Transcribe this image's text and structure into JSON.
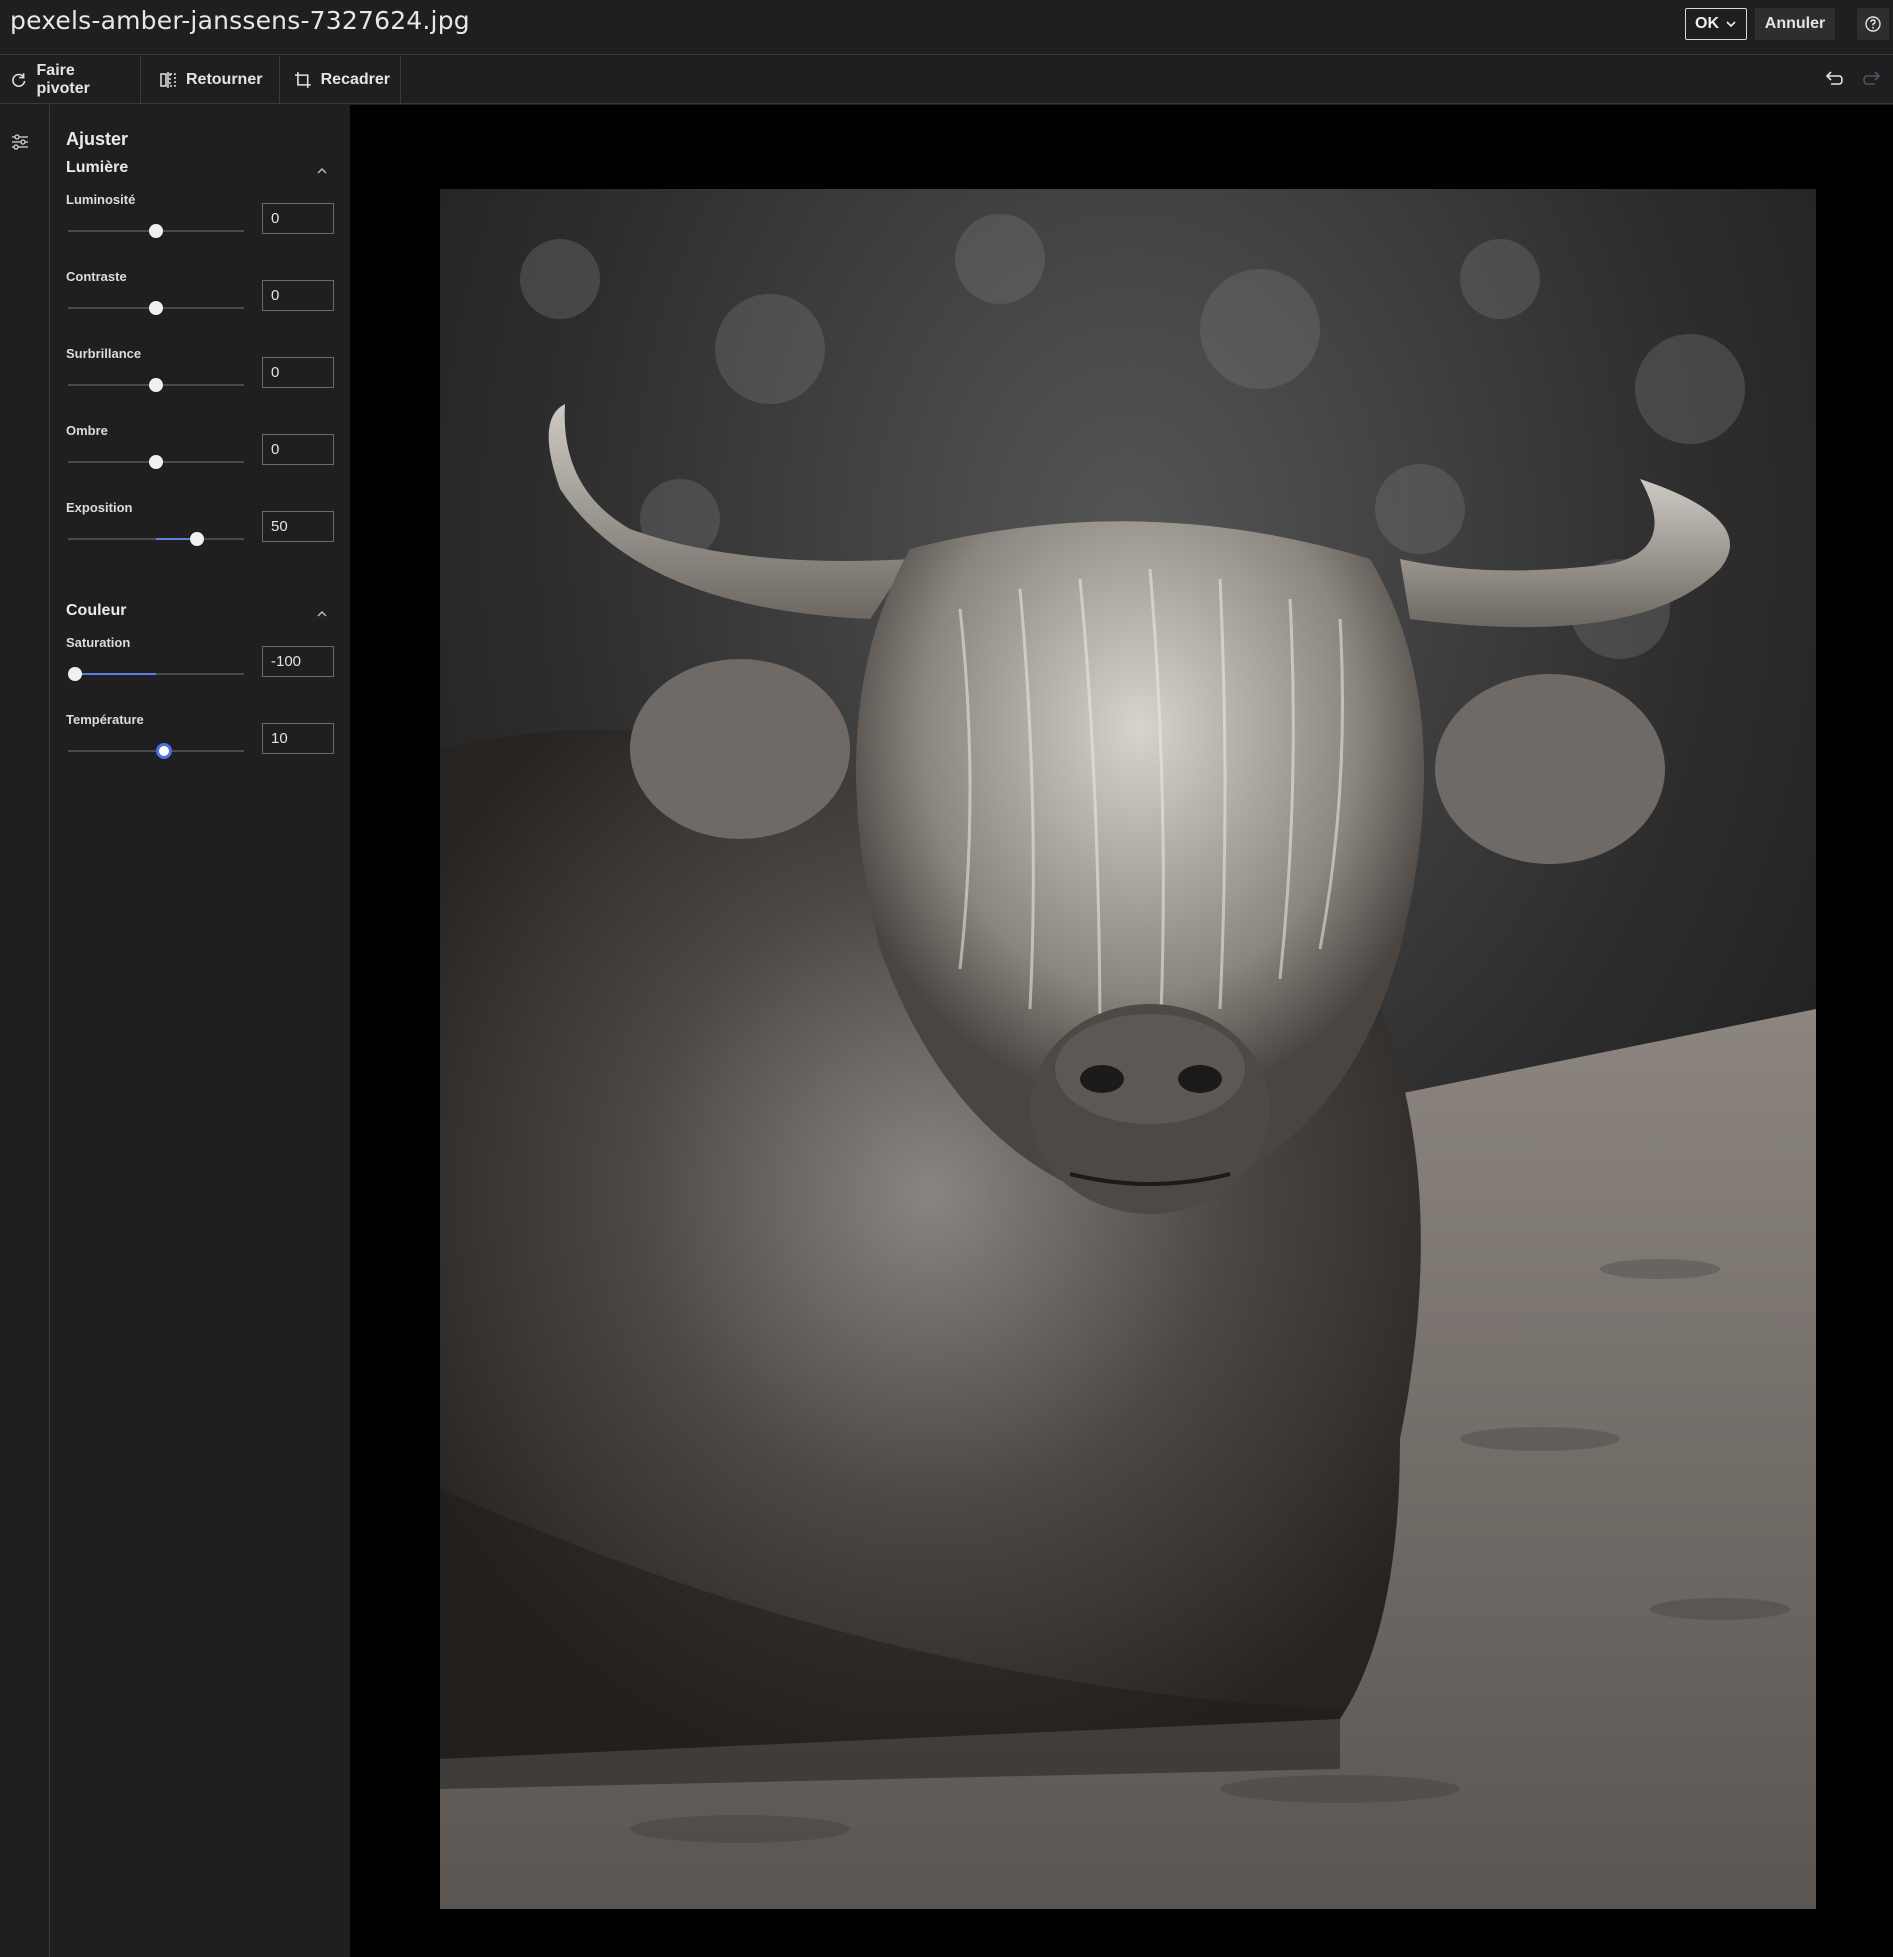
{
  "window": {
    "title": "pexels-amber-janssens-7327624.jpg"
  },
  "actions": {
    "ok_label": "OK",
    "cancel_label": "Annuler"
  },
  "toolbar": {
    "rotate_label": "Faire pivoter",
    "flip_label": "Retourner",
    "crop_label": "Recadrer"
  },
  "panel": {
    "title": "Ajuster",
    "light": {
      "title": "Lumière",
      "brightness": {
        "label": "Luminosité",
        "value": "0"
      },
      "contrast": {
        "label": "Contraste",
        "value": "0"
      },
      "highlights": {
        "label": "Surbrillance",
        "value": "0"
      },
      "shadows": {
        "label": "Ombre",
        "value": "0"
      },
      "exposure": {
        "label": "Exposition",
        "value": "50"
      }
    },
    "color": {
      "title": "Couleur",
      "saturation": {
        "label": "Saturation",
        "value": "-100"
      },
      "temperature": {
        "label": "Température",
        "value": "10"
      }
    }
  },
  "icons": {
    "rotate": "rotate-icon",
    "flip": "flip-icon",
    "crop": "crop-icon",
    "undo": "undo-icon",
    "redo": "redo-icon",
    "help": "help-icon",
    "adjust": "sliders-icon",
    "ok_dropdown": "chevron-down-icon",
    "collapse": "chevron-up-icon"
  },
  "colors": {
    "accent": "#5b7fe0",
    "background": "#1f1f21",
    "canvas": "#000000"
  }
}
